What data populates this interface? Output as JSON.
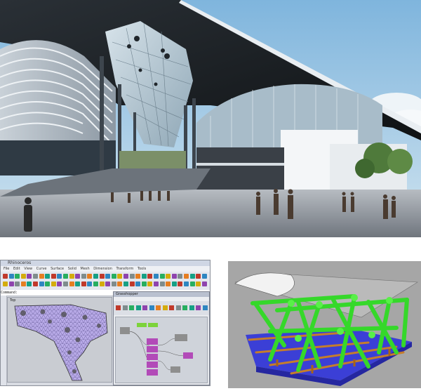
{
  "software_window": {
    "title": "Rhinoceros",
    "menu_items": [
      "File",
      "Edit",
      "View",
      "Curve",
      "Surface",
      "Solid",
      "Mesh",
      "Dimension",
      "Transform",
      "Tools"
    ],
    "command_prompt": "Command:",
    "viewport_label": "Top",
    "grasshopper_title": "Grasshopper"
  },
  "colors": {
    "sky": "#a9cfe6",
    "roof_dark": "#1c2024",
    "plaza": "#9aa0a6",
    "grasshopper_green": "#7cd33a",
    "mesh_purple": "#b7a9e6",
    "model_background": "#a6a6a6",
    "struct_green": "#38e02a",
    "slab_blue": "#3a3fd8",
    "joist_orange": "#c07c2a"
  },
  "icons": [
    "rhino-toolbar-icons",
    "grasshopper-component-icons"
  ]
}
